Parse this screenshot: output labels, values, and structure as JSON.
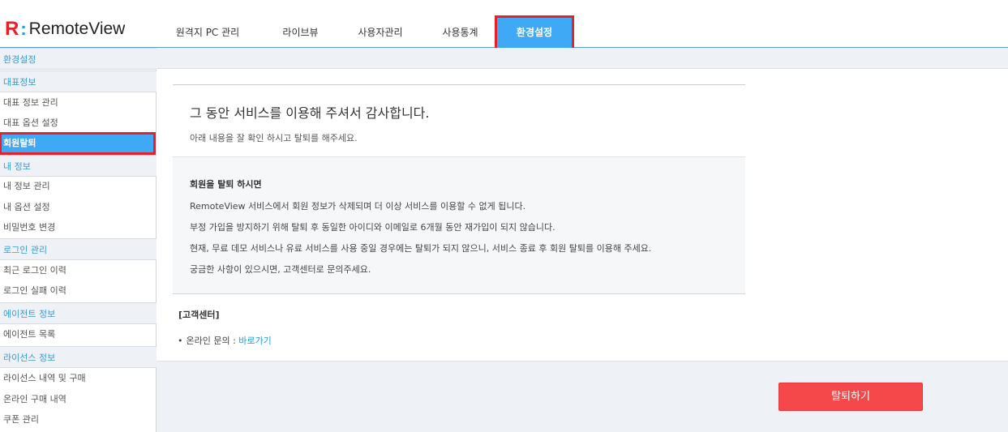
{
  "brand": {
    "mark": "R",
    "separator": ":",
    "name": "RemoteView"
  },
  "nav": [
    {
      "label": "원격지 PC 관리",
      "active": false
    },
    {
      "label": "라이브뷰",
      "active": false
    },
    {
      "label": "사용자관리",
      "active": false
    },
    {
      "label": "사용통계",
      "active": false
    },
    {
      "label": "환경설정",
      "active": true
    }
  ],
  "sidebar": {
    "header": "환경설정",
    "groups": [
      {
        "title": "대표정보",
        "items": [
          "대표 정보 관리",
          "대표 옵션 설정",
          "회원탈퇴"
        ]
      },
      {
        "title": "내 정보",
        "items": [
          "내 정보 관리",
          "내 옵션 설정",
          "비밀번호 변경"
        ]
      },
      {
        "title": "로그인 관리",
        "items": [
          "최근 로그인 이력",
          "로그인 실패 이력"
        ]
      },
      {
        "title": "에이전트 정보",
        "items": [
          "에이전트 목록"
        ]
      },
      {
        "title": "라이선스 정보",
        "items": [
          "라이선스 내역 및 구매",
          "온라인 구매 내역",
          "쿠폰 관리"
        ]
      }
    ],
    "active_item": "회원탈퇴"
  },
  "main": {
    "heading": "그 동안 서비스를 이용해 주셔서 감사합니다.",
    "subheading": "아래 내용을 잘 확인 하시고 탈퇴를 해주세요.",
    "notice": {
      "title": "회원을 탈퇴 하시면",
      "lines": [
        "RemoteView 서비스에서 회원 정보가 삭제되며 더 이상 서비스를 이용할 수 없게 됩니다.",
        "부정 가입을 방지하기 위해 탈퇴 후 동일한 아이디와 이메일로 6개월 동안 재가입이 되지 않습니다.",
        "현재, 무료 데모 서비스나 유료 서비스를 사용 중일 경우에는 탈퇴가 되지 않으니, 서비스 종료 후 회원 탈퇴를 이용해 주세요.",
        "궁금한 사항이 있으시면, 고객센터로 문의주세요."
      ]
    },
    "customer_center": {
      "title": "[고객센터]",
      "bullet": "•",
      "label": "온라인 문의 : ",
      "link": "바로가기"
    },
    "withdraw_button": "탈퇴하기"
  },
  "colors": {
    "accent": "#3fa9f5",
    "highlight_border": "#e8202a",
    "danger_button": "#f5484b",
    "link": "#1a9fd8"
  }
}
